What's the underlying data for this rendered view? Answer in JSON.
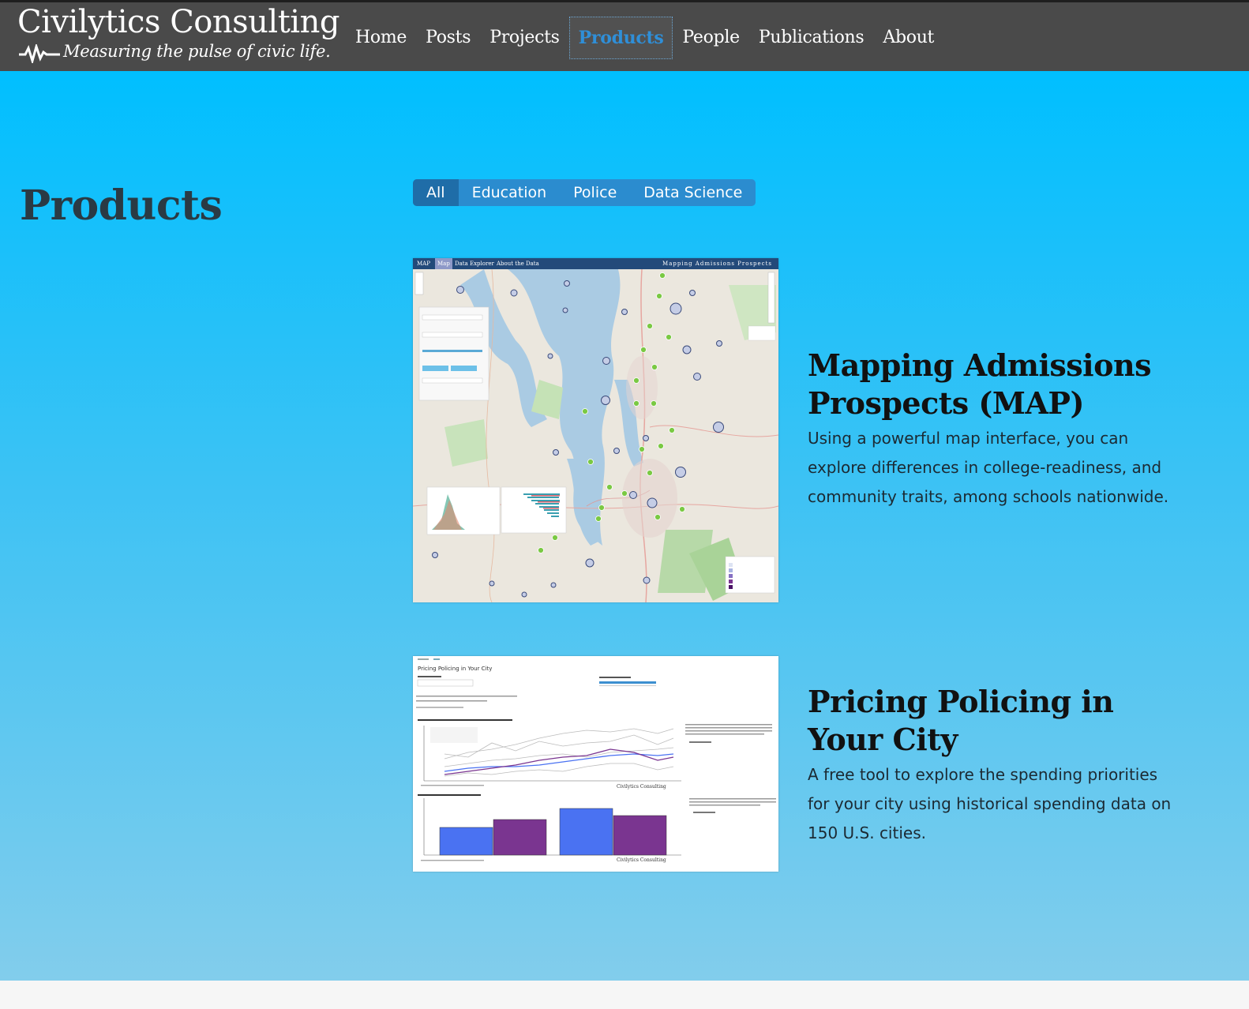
{
  "brand": {
    "title": "Civilytics Consulting",
    "tagline": "Measuring the pulse of civic life."
  },
  "nav": {
    "items": [
      {
        "label": "Home",
        "active": false
      },
      {
        "label": "Posts",
        "active": false
      },
      {
        "label": "Projects",
        "active": false
      },
      {
        "label": "Products",
        "active": true
      },
      {
        "label": "People",
        "active": false
      },
      {
        "label": "Publications",
        "active": false
      },
      {
        "label": "About",
        "active": false
      }
    ]
  },
  "page": {
    "title": "Products"
  },
  "filters": {
    "items": [
      {
        "label": "All",
        "active": true
      },
      {
        "label": "Education",
        "active": false
      },
      {
        "label": "Police",
        "active": false
      },
      {
        "label": "Data Science",
        "active": false
      }
    ]
  },
  "products": [
    {
      "title": "Mapping Admissions Prospects (MAP)",
      "description": "Using a powerful map interface, you can explore differences in college-readiness, and community traits, among schools nationwide.",
      "thumb": {
        "topbar_left": [
          "MAP",
          "Map",
          "Data Explorer",
          "About the Data"
        ],
        "topbar_right": "Mapping Admissions Prospects"
      }
    },
    {
      "title": "Pricing Policing in Your City",
      "description": "A free tool to explore the spending priorities for your city using historical spending data on 150 U.S. cities.",
      "thumb": {
        "heading": "Pricing Policing in Your City",
        "brand_mark": "Civilytics Consulting"
      }
    }
  ],
  "colors": {
    "navbar": "#4a4a4a",
    "nav_active": "#2f8fd8",
    "filter_bg": "#2b8ccf",
    "filter_active": "#1f6da8",
    "bar_blue": "#4a72f2",
    "bar_purple": "#7a3590"
  }
}
